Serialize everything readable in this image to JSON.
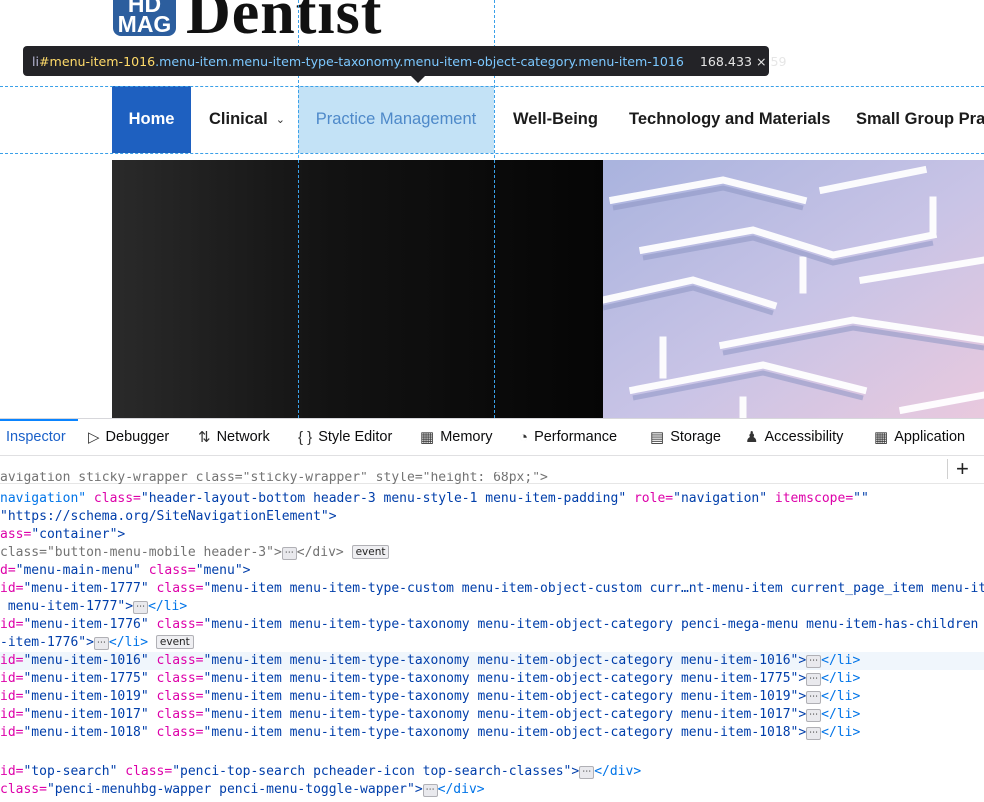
{
  "site": {
    "logo_badge_line1": "HD",
    "logo_badge_line2": "MAG",
    "logo_word": "Dentist",
    "brand_color": "#2c5e9e"
  },
  "tooltip": {
    "tag": "li",
    "id": "#menu-item-1016",
    "classes": ".menu-item.menu-item-type-taxonomy.menu-item-object-category.menu-item-1016",
    "dimensions": "168.433 × 59"
  },
  "nav": {
    "home": "Home",
    "clinical": "Clinical",
    "practice": "Practice Management",
    "wellbeing": "Well-Being",
    "tech": "Technology and Materials",
    "small_group": "Small Group Prac",
    "active_color": "#1e60c0",
    "highlight_color": "#c3e2f6"
  },
  "devtools": {
    "tabs": {
      "inspector": "Inspector",
      "debugger": "Debugger",
      "network": "Network",
      "style_editor": "Style Editor",
      "memory": "Memory",
      "performance": "Performance",
      "storage": "Storage",
      "accessibility": "Accessibility",
      "application": "Application"
    },
    "add_label": "+",
    "lines": {
      "l0": "avigation sticky-wrapper class=\"sticky-wrapper\" style=\"height: 68px;\">",
      "l1_pre": "navigation\"",
      "l1_attr": " class=",
      "l1_val": "\"header-layout-bottom header-3 menu-style-1 menu-item-padding\"",
      "l1_attr2": " role=",
      "l1_val2": "\"navigation\"",
      "l1_attr3": " itemscope=",
      "l1_val3": "\"\"",
      "l2": "\"https://schema.org/SiteNavigationElement\">",
      "l3_attr": "ass=",
      "l3_val": "\"container\">",
      "l4_attr": "class=",
      "l4_val": "\"button-menu-mobile header-3\">",
      "l4_close": "</div>",
      "l5_pre": "d=",
      "l5_val": "\"menu-main-menu\"",
      "l5_attr": " class=",
      "l5_val2": "\"menu\">",
      "l6_pre": "id=",
      "l6_val": "\"menu-item-1777\"",
      "l6_attr": " class=",
      "l6_val2": "\"menu-item menu-item-type-custom menu-item-object-custom curr…nt-menu-item current_page_item menu-ite",
      "l7_val": " menu-item-1777\">",
      "l7_close": "</li>",
      "l8_pre": "id=",
      "l8_val": "\"menu-item-1776\"",
      "l8_attr": " class=",
      "l8_val2": "\"menu-item menu-item-type-taxonomy menu-item-object-category penci-mega-menu menu-item-has-children",
      "l9_val": "-item-1776\">",
      "l9_close": "</li>",
      "event": "event",
      "l10_pre": "id=",
      "l10_val": "\"menu-item-1016\"",
      "l10_attr": " class=",
      "l10_val2": "\"menu-item menu-item-type-taxonomy menu-item-object-category menu-item-1016\">",
      "l10_close": "</li>",
      "l11_pre": "id=",
      "l11_val": "\"menu-item-1775\"",
      "l11_attr": " class=",
      "l11_val2": "\"menu-item menu-item-type-taxonomy menu-item-object-category menu-item-1775\">",
      "l11_close": "</li>",
      "l12_pre": "id=",
      "l12_val": "\"menu-item-1019\"",
      "l12_attr": " class=",
      "l12_val2": "\"menu-item menu-item-type-taxonomy menu-item-object-category menu-item-1019\">",
      "l12_close": "</li>",
      "l13_pre": "id=",
      "l13_val": "\"menu-item-1017\"",
      "l13_attr": " class=",
      "l13_val2": "\"menu-item menu-item-type-taxonomy menu-item-object-category menu-item-1017\">",
      "l13_close": "</li>",
      "l14_pre": "id=",
      "l14_val": "\"menu-item-1018\"",
      "l14_attr": " class=",
      "l14_val2": "\"menu-item menu-item-type-taxonomy menu-item-object-category menu-item-1018\">",
      "l14_close": "</li>",
      "l15_pre": "id=",
      "l15_val": "\"top-search\"",
      "l15_attr": " class=",
      "l15_val2": "\"penci-top-search pcheader-icon top-search-classes\">",
      "l15_close": "</div>",
      "l16_attr": "class=",
      "l16_val": "\"penci-menuhbg-wapper penci-menu-toggle-wapper\">",
      "l16_close": "</div>"
    }
  }
}
